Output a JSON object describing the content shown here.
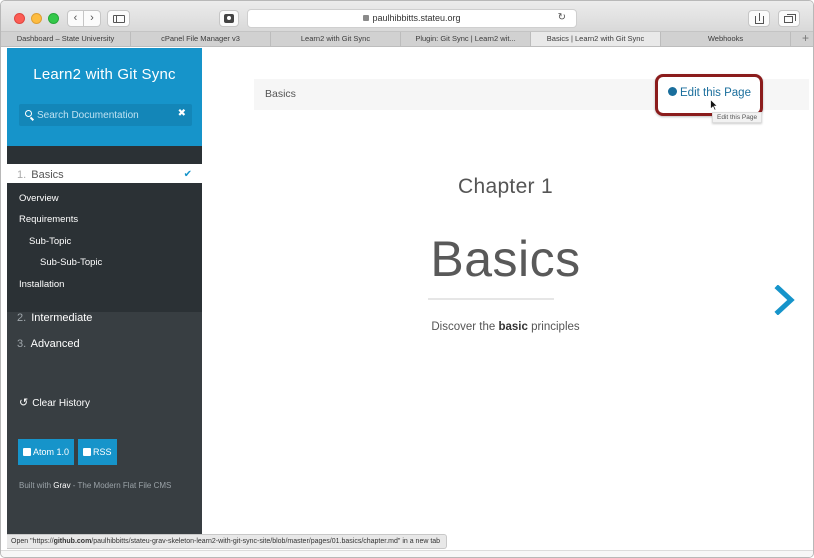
{
  "browser": {
    "url": "paulhibbitts.stateu.org",
    "tabs": [
      {
        "label": "Dashboard – State University",
        "active": false
      },
      {
        "label": "cPanel File Manager v3",
        "active": false
      },
      {
        "label": "Learn2 with Git Sync",
        "active": false
      },
      {
        "label": "Plugin: Git Sync | Learn2 wit...",
        "active": false
      },
      {
        "label": "Basics | Learn2 with Git Sync",
        "active": true
      },
      {
        "label": "Webhooks",
        "active": false
      }
    ],
    "new_tab_label": "+",
    "status_prefix": "Open \"https://",
    "status_host": "github.com",
    "status_rest": "/paulhibbitts/stateu-grav-skeleton-learn2-with-git-sync-site/blob/master/pages/01.basics/chapter.md\" in a new tab"
  },
  "sidebar": {
    "title": "Learn2 with Git Sync",
    "search_placeholder": "Search Documentation",
    "chapters": [
      {
        "num": "1.",
        "label": "Basics",
        "active": true
      },
      {
        "num": "2.",
        "label": "Intermediate",
        "active": false
      },
      {
        "num": "3.",
        "label": "Advanced",
        "active": false
      }
    ],
    "subitems": [
      {
        "label": "Overview"
      },
      {
        "label": "Requirements"
      },
      {
        "label": "Sub-Topic"
      },
      {
        "label": "Sub-Sub-Topic"
      },
      {
        "label": "Installation"
      }
    ],
    "clear_history": "Clear History",
    "atom_label": "Atom 1.0",
    "rss_label": "RSS",
    "built_with_prefix": "Built with ",
    "built_with_grav": "Grav",
    "built_with_suffix": " - The Modern Flat File CMS"
  },
  "main": {
    "breadcrumb": "Basics",
    "edit_link": "Edit this Page",
    "tooltip": "Edit this Page",
    "chapter_label": "Chapter 1",
    "heading": "Basics",
    "description_prefix": "Discover the ",
    "description_bold": "basic",
    "description_suffix": " principles"
  },
  "colors": {
    "accent": "#1694ca",
    "sidebar_bg": "#383e42",
    "highlight_border": "#8b1c1c",
    "link": "#1a6e9c"
  }
}
